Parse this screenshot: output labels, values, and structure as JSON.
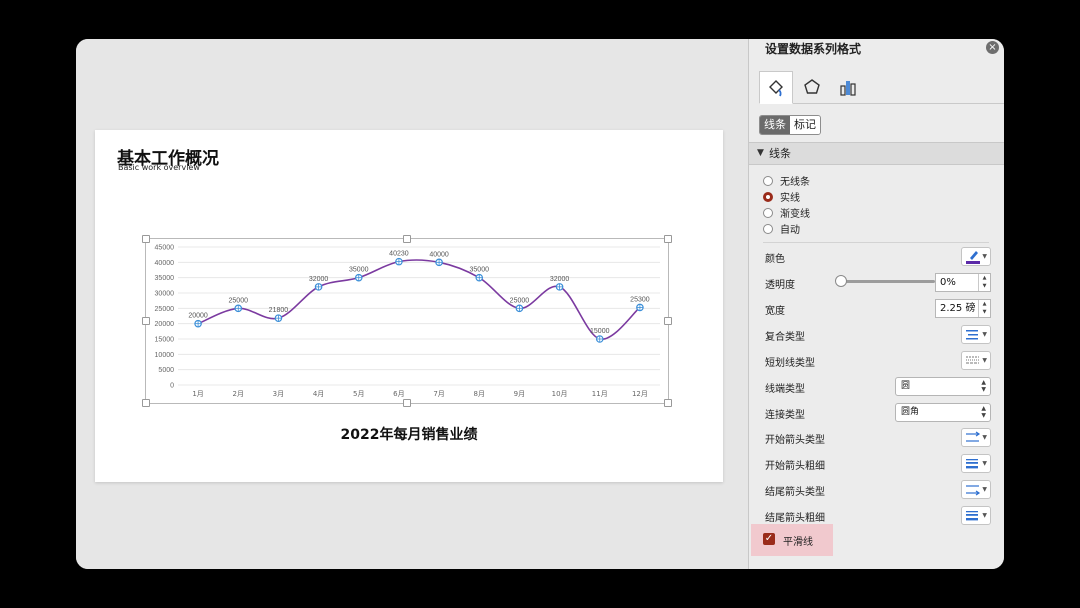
{
  "slide": {
    "title": "基本工作概况",
    "subtitle": "Basic work overview",
    "chart_caption": "2022年每月销售业绩"
  },
  "chart_data": {
    "type": "line",
    "categories": [
      "1月",
      "2月",
      "3月",
      "4月",
      "5月",
      "6月",
      "7月",
      "8月",
      "9月",
      "10月",
      "11月",
      "12月"
    ],
    "series": [
      {
        "values": [
          20000,
          25000,
          21800,
          32000,
          35000,
          40230,
          40000,
          35000,
          25000,
          32000,
          15000,
          25300
        ]
      }
    ],
    "data_labels": [
      "20000",
      "25000",
      "21800",
      "32000",
      "35000",
      "40230",
      "40000",
      "35000",
      "25000",
      "32000",
      "15000",
      "25300"
    ],
    "y_ticks": [
      "0",
      "5000",
      "10000",
      "15000",
      "20000",
      "25000",
      "30000",
      "35000",
      "40000",
      "45000"
    ],
    "ylim": [
      0,
      45000
    ],
    "smooth": true,
    "grid": true,
    "line_color": "#7b3aa0",
    "marker_color": "#3c8fd8",
    "title": "2022年每月销售业绩"
  },
  "panel": {
    "title": "设置数据系列格式",
    "close_icon": "close-icon",
    "tabs": [
      "fill-line-icon",
      "pentagon-effects-icon",
      "bar-chart-options-icon"
    ],
    "segments": {
      "line": "线条",
      "marker": "标记"
    },
    "section": "线条",
    "line_options": [
      "无线条",
      "实线",
      "渐变线",
      "自动"
    ],
    "selected_option": "实线",
    "props": {
      "color": "颜色",
      "transparency": "透明度",
      "width": "宽度",
      "compound_type": "复合类型",
      "dash_type": "短划线类型",
      "cap_type": "线端类型",
      "join_type": "连接类型",
      "begin_arrow_type": "开始箭头类型",
      "begin_arrow_size": "开始箭头粗细",
      "end_arrow_type": "结尾箭头类型",
      "end_arrow_size": "结尾箭头粗细",
      "smooth": "平滑线"
    },
    "values": {
      "transparency": "0%",
      "transparency_level": 0,
      "width": "2.25 磅",
      "cap_type": "圆",
      "join_type": "圆角",
      "smooth_checked": true
    },
    "colors": {
      "accent": "#9a2b1a",
      "line_color_swatch": "#5b2aa8"
    }
  }
}
